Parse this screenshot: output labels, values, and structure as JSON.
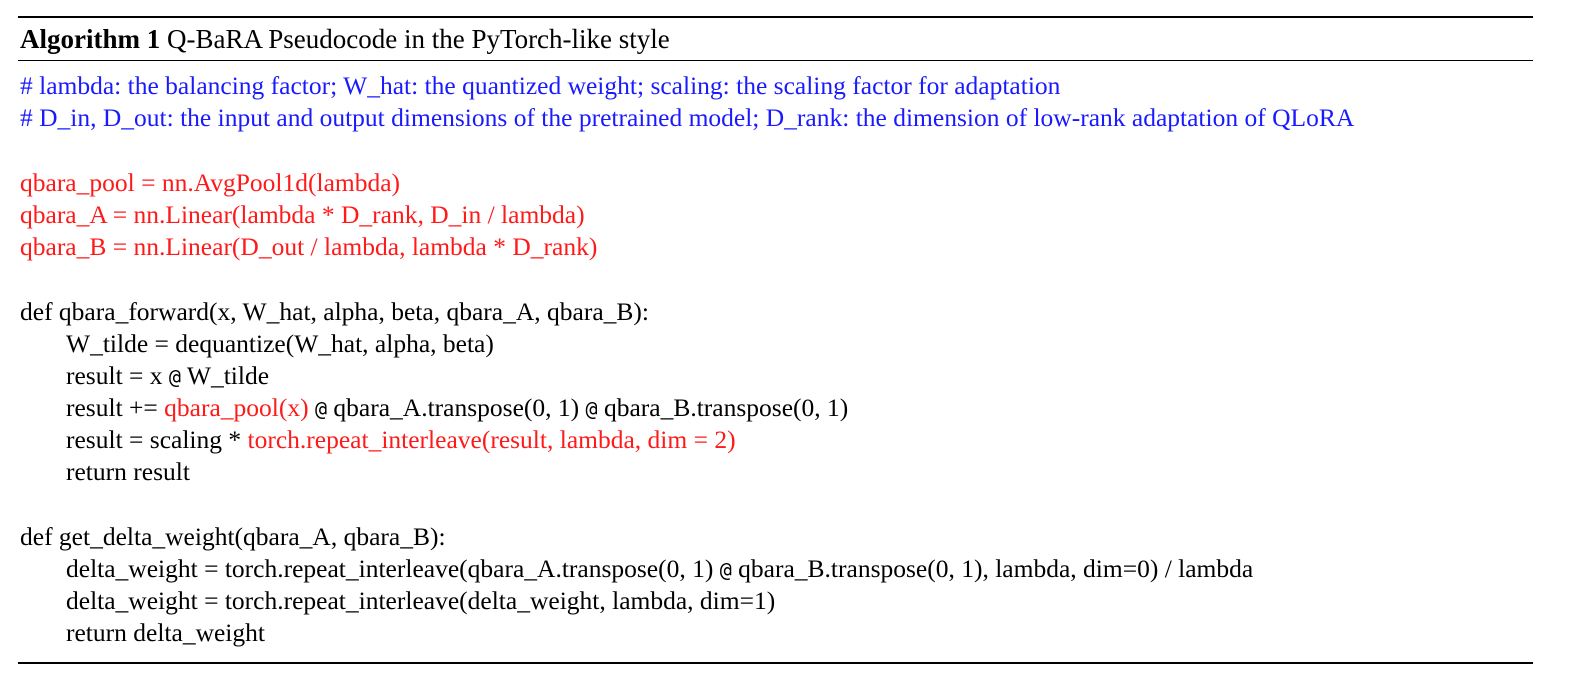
{
  "algorithm": {
    "label": "Algorithm 1",
    "title": "Q-BaRA Pseudocode in the PyTorch-like style"
  },
  "comments": [
    "# lambda: the balancing factor; W_hat: the quantized weight; scaling: the scaling factor for adaptation",
    "# D_in, D_out: the input and output dimensions of the pretrained model; D_rank: the dimension of low-rank adaptation of QLoRA"
  ],
  "init_lines": [
    "qbara_pool = nn.AvgPool1d(lambda)",
    "qbara_A = nn.Linear(lambda * D_rank, D_in / lambda)",
    "qbara_B = nn.Linear(D_out / lambda, lambda * D_rank)"
  ],
  "forward": {
    "signature": "def qbara_forward(x, W_hat, alpha, beta, qbara_A, qbara_B):",
    "line1": "W_tilde = dequantize(W_hat, alpha, beta)",
    "line2_a": "result = x ",
    "at": "@",
    "line2_b": " W_tilde",
    "line3_a": "result += ",
    "line3_red": "qbara_pool(x)",
    "line3_b": " qbara_A.transpose(0, 1) ",
    "line3_c": " qbara_B.transpose(0, 1)",
    "line4_a": "result = scaling * ",
    "line4_red": "torch.repeat_interleave(result, lambda, dim = 2)",
    "line5": "return result"
  },
  "delta": {
    "signature": "def get_delta_weight(qbara_A, qbara_B):",
    "line1_a": "delta_weight = torch.repeat_interleave(qbara_A.transpose(0, 1) ",
    "line1_b": " qbara_B.transpose(0, 1), lambda, dim=0) / lambda",
    "line2": "delta_weight = torch.repeat_interleave(delta_weight, lambda, dim=1)",
    "line3": "return delta_weight"
  },
  "colors": {
    "comment": "#1a1aff",
    "highlight": "#ff1a1a",
    "text": "#000000"
  }
}
